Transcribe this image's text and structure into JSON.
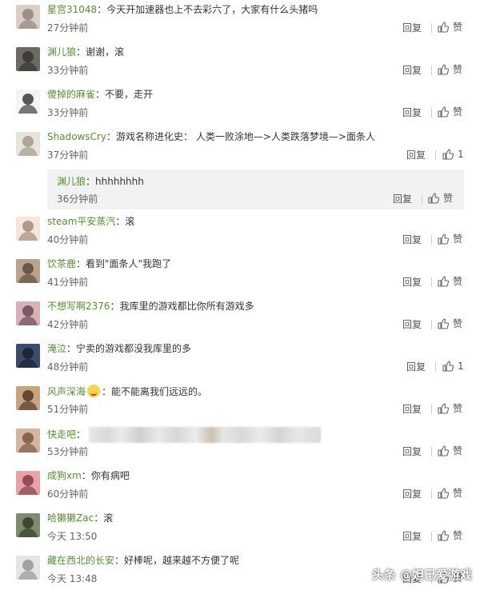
{
  "labels": {
    "reply": "回复",
    "like": "赞"
  },
  "comments": [
    {
      "user": "星宫31048",
      "text": "今天开加速器也上不去彩六了，大家有什么头猪吗",
      "time": "27分钟前",
      "likes": "赞",
      "avatar": [
        "#d9cfc7",
        "#8a7a6e"
      ]
    },
    {
      "user": "渊儿狼",
      "text": "谢谢，滚",
      "time": "33分钟前",
      "likes": "赞",
      "avatar": [
        "#6d6a66",
        "#2f2c2a"
      ]
    },
    {
      "user": "傻掉的麻雀",
      "text": "不要，走开",
      "time": "33分钟前",
      "likes": "赞",
      "avatar": [
        "#f4f4f4",
        "#222222"
      ]
    },
    {
      "user": "ShadowsCry",
      "text": "游戏名称进化史：  人类一败涂地—>人类跌落梦境—>面条人",
      "time": "37分钟前",
      "likes": "1",
      "avatar": [
        "#e8e4dc",
        "#9b8f80"
      ]
    },
    {
      "user": "steam平安蒸汽",
      "text": "滚",
      "time": "40分钟前",
      "likes": "赞",
      "avatar": [
        "#f3e6dc",
        "#9a7f6a"
      ]
    },
    {
      "user": "饮茶鹿",
      "text": "看到\"面条人\"我跑了",
      "time": "41分钟前",
      "likes": "赞",
      "avatar": [
        "#b9a38c",
        "#4d4136"
      ]
    },
    {
      "user": "不想写啊2376",
      "text": "我库里的游戏都比你所有游戏多",
      "time": "42分钟前",
      "likes": "赞",
      "avatar": [
        "#d8b0b8",
        "#5b3b4a"
      ]
    },
    {
      "user": "淹泣",
      "text": "宁卖的游戏都没我库里的多",
      "time": "48分钟前",
      "likes": "1",
      "avatar": [
        "#3d4b6b",
        "#141a28"
      ]
    },
    {
      "user": "风声深海",
      "text": "能不能离我们远远的。",
      "time": "51分钟前",
      "likes": "赞",
      "avatar": [
        "#c9a57d",
        "#3c2c20"
      ],
      "emoji": true
    },
    {
      "user": "快走吧",
      "text": "",
      "time": "53分钟前",
      "likes": "赞",
      "avatar": [
        "#d4b5a0",
        "#6f4a3a"
      ],
      "blurred": true
    },
    {
      "user": "成狗xm",
      "text": "你有病吧",
      "time": "60分钟前",
      "likes": "赞",
      "avatar": [
        "#e7a3a8",
        "#7a2f3a"
      ]
    },
    {
      "user": "哈獭獭Zac",
      "text": "滚",
      "time": "今天 13:50",
      "likes": "赞",
      "avatar": [
        "#7f8a6f",
        "#2b3022"
      ]
    },
    {
      "user": "藏在西北的长安",
      "text": "好棒呢，越来越不方便了呢",
      "time": "今天 13:48",
      "likes": "赞",
      "avatar": [
        "#e5e5e5",
        "#8a8a8a"
      ]
    }
  ],
  "subreply": {
    "user": "渊儿狼",
    "text": "hhhhhhhh",
    "time": "36分钟前",
    "likes": "赞"
  },
  "watermark": "头条 @妲己爱游戏"
}
